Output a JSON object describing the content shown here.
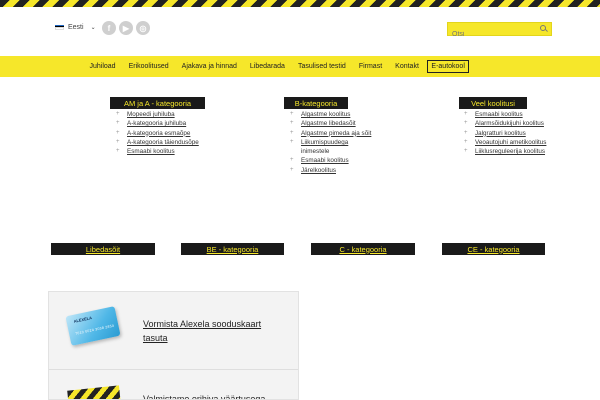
{
  "header": {
    "language": "Eesti",
    "social": [
      "facebook-icon",
      "youtube-icon",
      "instagram-icon"
    ],
    "search_placeholder": "Otsi"
  },
  "nav": {
    "items": [
      "Juhiload",
      "Erikoolitused",
      "Ajakava ja hinnad",
      "Libedarada",
      "Tasulised testid",
      "Firmast",
      "Kontakt",
      "E-autokool"
    ]
  },
  "columns": [
    {
      "title": "AM ja A - kategooria",
      "links": [
        "Mopeedi juhiluba",
        "A-kategooria juhiluba",
        "A-kategooria esmaõpe",
        "A-kategooria täiendusõpe",
        "Esmaabi koolitus"
      ]
    },
    {
      "title": "B-kategooria",
      "links": [
        "Algastme koolitus",
        "Algastme libedasõit",
        "Algastme pimeda aja sõit",
        "Liikumispuudega",
        "inimestele",
        "Esmaabi koolitus",
        "Järelkoolitus"
      ]
    },
    {
      "title": "Veel koolitusi",
      "links": [
        "Esmaabi koolitus",
        "Alarmsõidukijuhi koolitus",
        "Jalgratturi koolitus",
        "Veoautojuhi ametikoolitus",
        "Liiklusreguleerija koolitus"
      ]
    }
  ],
  "categories": [
    "Libedasõit",
    "BE - kategooria",
    "C - kategooria",
    "CE - kategooria"
  ],
  "promo": {
    "card_brand": "ALEXELA",
    "card_number": "7010 0024 3038 2854",
    "item1": "Vormista Alexela sooduskaart tasuta",
    "item2": "Valmistame erihiva väärtusega"
  },
  "colors": {
    "brand_yellow": "#f6e72a",
    "dark": "#1a1a1a"
  }
}
